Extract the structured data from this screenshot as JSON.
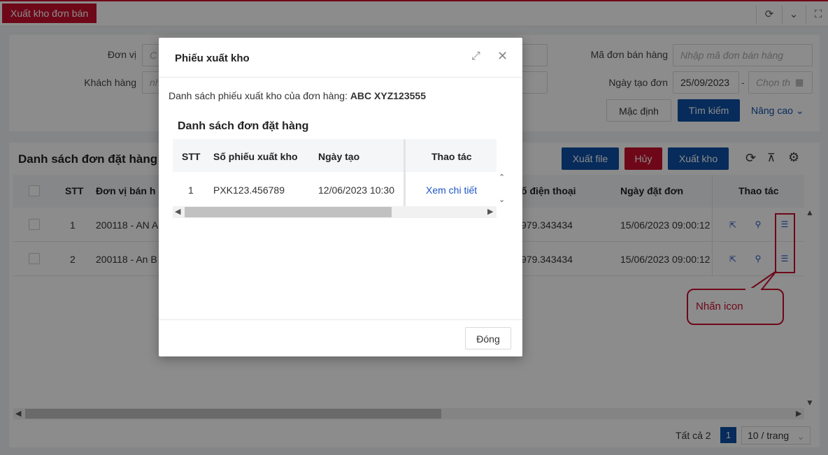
{
  "topbar": {
    "tab_label": "Xuất kho đơn bán",
    "icons": [
      "refresh-icon",
      "chevron-down-icon",
      "fullscreen-icon"
    ]
  },
  "filter": {
    "don_vi_label": "Đơn vị",
    "don_vi_placeholder": "C",
    "khach_hang_label": "Khách hàng",
    "khach_hang_placeholder": "nh",
    "ma_don_label": "Mã đơn bán hàng",
    "ma_don_placeholder": "Nhập mã đơn bán hàng",
    "ngay_tao_label": "Ngày tạo đơn",
    "ngay_tu_value": "25/09/2023",
    "ngay_sep": "-",
    "ngay_den_placeholder": "Chọn th",
    "btn_default": "Mặc định",
    "btn_search": "Tìm kiếm",
    "btn_advanced": "Nâng cao"
  },
  "list": {
    "title": "Danh sách đơn đặt hàng",
    "btn_export_file": "Xuất file",
    "btn_cancel": "Hủy",
    "btn_export_stock": "Xuất kho",
    "columns": {
      "stt": "STT",
      "don_vi": "Đơn vị bán h",
      "phone": "ố điện thoại",
      "ngay_dat": "Ngày đặt đơn",
      "thao_tac": "Thao tác"
    },
    "rows": [
      {
        "stt": "1",
        "don_vi": "200118 - AN A",
        "phone": "979.343434",
        "ngay_dat": "15/06/2023 09:00:12"
      },
      {
        "stt": "2",
        "don_vi": "200118 - An B",
        "phone": "979.343434",
        "ngay_dat": "15/06/2023 09:00:12"
      }
    ]
  },
  "pagination": {
    "total": "Tất cả 2",
    "page": "1",
    "per_page": "10 / trang"
  },
  "modal": {
    "title": "Phiếu xuất kho",
    "desc_prefix": "Danh sách phiếu xuất kho của đơn hàng:",
    "order_code": "ABC XYZ123555",
    "section_title": "Danh sách đơn đặt hàng",
    "columns": {
      "stt": "STT",
      "so_phieu": "Số phiếu xuất kho",
      "ngay_tao": "Ngày tạo",
      "thao_tac": "Thao tác"
    },
    "rows": [
      {
        "stt": "1",
        "so_phieu": "PXK123.456789",
        "ngay_tao": "12/06/2023 10:30",
        "action": "Xem chi tiết"
      }
    ],
    "close_button": "Đóng"
  },
  "annotation": {
    "text": "Nhấn icon"
  },
  "colors": {
    "brand_red": "#c8102e",
    "primary_blue": "#0d4fa5",
    "link_blue": "#1e56c8"
  }
}
